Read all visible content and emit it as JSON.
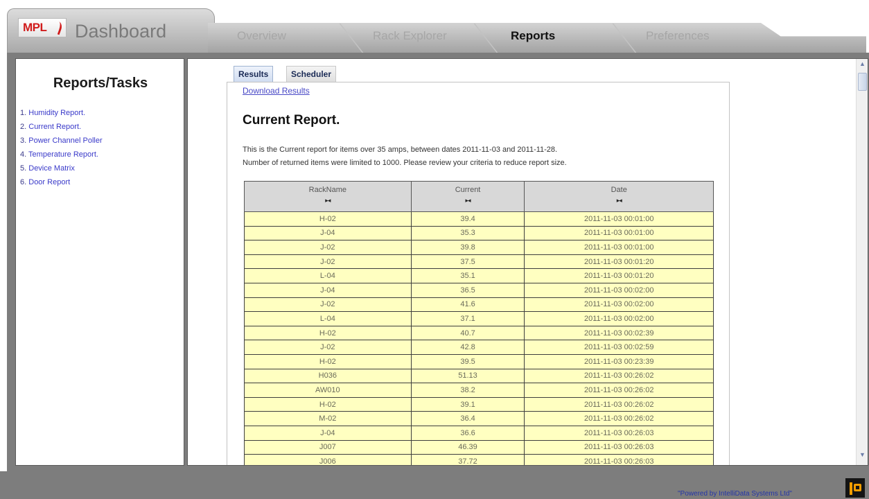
{
  "app": {
    "logo_text": "MPL",
    "title": "Dashboard"
  },
  "nav": {
    "tabs": [
      {
        "label": "Overview",
        "active": false
      },
      {
        "label": "Rack Explorer",
        "active": false
      },
      {
        "label": "Reports",
        "active": true
      },
      {
        "label": "Preferences",
        "active": false
      }
    ]
  },
  "sidebar": {
    "title": "Reports/Tasks",
    "items": [
      {
        "num": "1.",
        "label": "Humidity Report."
      },
      {
        "num": "2.",
        "label": "Current Report."
      },
      {
        "num": "3.",
        "label": "Power Channel Poller"
      },
      {
        "num": "4.",
        "label": "Temperature Report."
      },
      {
        "num": "5.",
        "label": "Device Matrix"
      },
      {
        "num": "6.",
        "label": "Door Report"
      }
    ]
  },
  "main": {
    "tabs": [
      {
        "label": "Results",
        "active": true
      },
      {
        "label": "Scheduler",
        "active": false
      }
    ],
    "download_link": "Download Results",
    "report_title": "Current Report.",
    "description_line1": "This is the Current report for items over 35 amps, between dates 2011-11-03 and 2011-11-28.",
    "description_line2": "Number of returned items were limited to 1000. Please review your criteria to reduce report size.",
    "sort_glyph": "▸◂",
    "table": {
      "columns": [
        "RackName",
        "Current",
        "Date"
      ],
      "rows": [
        [
          "H-02",
          "39.4",
          "2011-11-03 00:01:00"
        ],
        [
          "J-04",
          "35.3",
          "2011-11-03 00:01:00"
        ],
        [
          "J-02",
          "39.8",
          "2011-11-03 00:01:00"
        ],
        [
          "J-02",
          "37.5",
          "2011-11-03 00:01:20"
        ],
        [
          "L-04",
          "35.1",
          "2011-11-03 00:01:20"
        ],
        [
          "J-04",
          "36.5",
          "2011-11-03 00:02:00"
        ],
        [
          "J-02",
          "41.6",
          "2011-11-03 00:02:00"
        ],
        [
          "L-04",
          "37.1",
          "2011-11-03 00:02:00"
        ],
        [
          "H-02",
          "40.7",
          "2011-11-03 00:02:39"
        ],
        [
          "J-02",
          "42.8",
          "2011-11-03 00:02:59"
        ],
        [
          "H-02",
          "39.5",
          "2011-11-03 00:23:39"
        ],
        [
          "H036",
          "51.13",
          "2011-11-03 00:26:02"
        ],
        [
          "AW010",
          "38.2",
          "2011-11-03 00:26:02"
        ],
        [
          "H-02",
          "39.1",
          "2011-11-03 00:26:02"
        ],
        [
          "M-02",
          "36.4",
          "2011-11-03 00:26:02"
        ],
        [
          "J-04",
          "36.6",
          "2011-11-03 00:26:03"
        ],
        [
          "J007",
          "46.39",
          "2011-11-03 00:26:03"
        ],
        [
          "J006",
          "37.72",
          "2011-11-03 00:26:03"
        ]
      ]
    }
  },
  "footer": {
    "powered_by": "\"Powered by IntelliData Systems Ltd\""
  },
  "scrollbar": {
    "up_glyph": "▲",
    "down_glyph": "▼"
  }
}
